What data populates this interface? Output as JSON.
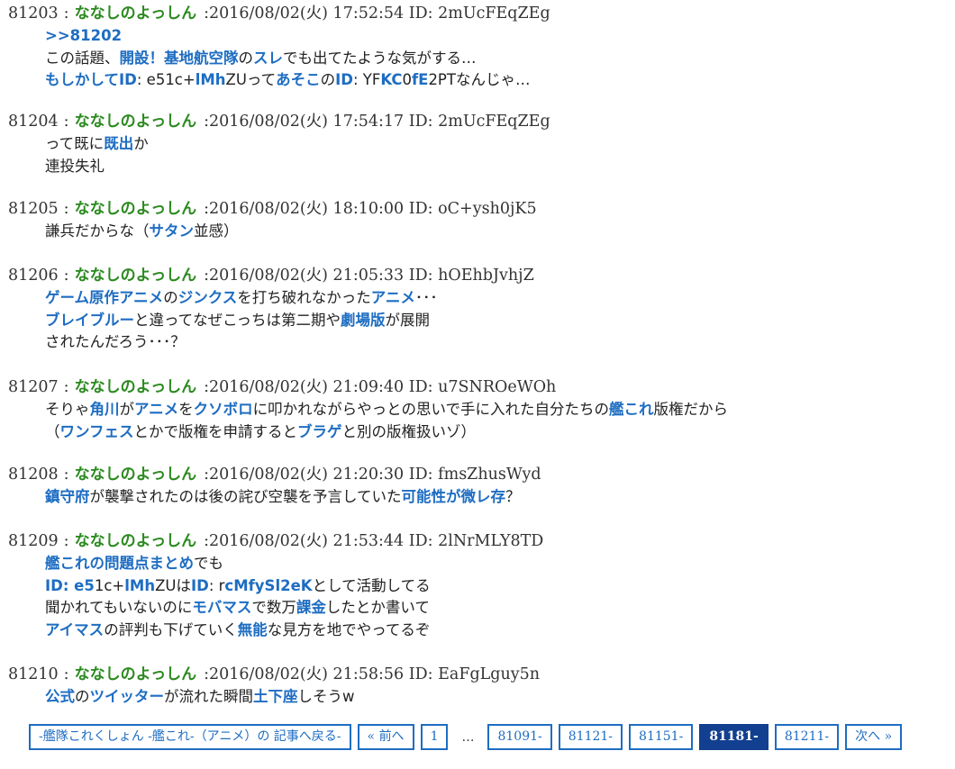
{
  "posts": [
    {
      "num": "81203",
      "name": "ななしのよっしん",
      "date": ":2016/08/02(火) 17:52:54 ID: 2mUcFEqZEg",
      "lines": [
        [
          {
            "t": ">>81202",
            "link": true
          }
        ],
        [
          {
            "t": "この話題、"
          },
          {
            "t": "開設！基地航空隊",
            "link": true
          },
          {
            "t": "の"
          },
          {
            "t": "スレ",
            "link": true
          },
          {
            "t": "でも出てたような気がする…"
          }
        ],
        [
          {
            "t": "もしかして",
            "link": true
          },
          {
            "t": "ID",
            "link": true
          },
          {
            "t": ": e5",
            "id": true
          },
          {
            "t": "1c+",
            "id": true
          },
          {
            "t": "lMh",
            "link": true
          },
          {
            "t": "ZUって"
          },
          {
            "t": "あそこ",
            "link": true
          },
          {
            "t": "の"
          },
          {
            "t": "ID",
            "link": true
          },
          {
            "t": ": YF"
          },
          {
            "t": "KC",
            "link": true
          },
          {
            "t": "0"
          },
          {
            "t": "fE",
            "link": true
          },
          {
            "t": "2PTなんじゃ…"
          }
        ]
      ]
    },
    {
      "num": "81204",
      "name": "ななしのよっしん",
      "date": ":2016/08/02(火) 17:54:17 ID: 2mUcFEqZEg",
      "lines": [
        [
          {
            "t": "って既に"
          },
          {
            "t": "既出",
            "link": true
          },
          {
            "t": "か"
          }
        ],
        [
          {
            "t": "連投失礼"
          }
        ]
      ]
    },
    {
      "num": "81205",
      "name": "ななしのよっしん",
      "date": ":2016/08/02(火) 18:10:00 ID: oC+ysh0jK5",
      "lines": [
        [
          {
            "t": "謙兵だからな（"
          },
          {
            "t": "サタン",
            "link": true
          },
          {
            "t": "並感）"
          }
        ]
      ]
    },
    {
      "num": "81206",
      "name": "ななしのよっしん",
      "date": ":2016/08/02(火) 21:05:33 ID: hOEhbJvhjZ",
      "lines": [
        [
          {
            "t": "ゲーム",
            "link": true
          },
          {
            "t": "原作",
            "link": true
          },
          {
            "t": "アニメ",
            "link": true
          },
          {
            "t": "の"
          },
          {
            "t": "ジンクス",
            "link": true
          },
          {
            "t": "を打ち破れなかった"
          },
          {
            "t": "アニメ",
            "link": true
          },
          {
            "t": "･･･"
          }
        ],
        [
          {
            "t": "ブレイブルー",
            "link": true
          },
          {
            "t": "と違ってなぜこっちは第二期や"
          },
          {
            "t": "劇場版",
            "link": true
          },
          {
            "t": "が展開"
          }
        ],
        [
          {
            "t": "されたんだろう･･･？"
          }
        ]
      ]
    },
    {
      "num": "81207",
      "name": "ななしのよっしん",
      "date": ":2016/08/02(火) 21:09:40 ID: u7SNROeWOh",
      "lines": [
        [
          {
            "t": "そりゃ"
          },
          {
            "t": "角川",
            "link": true
          },
          {
            "t": "が"
          },
          {
            "t": "アニメ",
            "link": true
          },
          {
            "t": "を"
          },
          {
            "t": "クソボロ",
            "link": true
          },
          {
            "t": "に叩かれながらやっとの思いで手に入れた自分たちの"
          },
          {
            "t": "艦これ",
            "link": true
          },
          {
            "t": "版権だから"
          }
        ],
        [
          {
            "t": "（"
          },
          {
            "t": "ワンフェス",
            "link": true
          },
          {
            "t": "とかで版権を申請すると"
          },
          {
            "t": "ブラゲ",
            "link": true
          },
          {
            "t": "と別の版権扱いゾ）"
          }
        ]
      ]
    },
    {
      "num": "81208",
      "name": "ななしのよっしん",
      "date": ":2016/08/02(火) 21:20:30 ID: fmsZhusWyd",
      "lines": [
        [
          {
            "t": "鎮守府",
            "link": true
          },
          {
            "t": "が襲撃されたのは後の詫び空襲を予言していた"
          },
          {
            "t": "可能性が微レ存",
            "link": true
          },
          {
            "t": "？"
          }
        ]
      ]
    },
    {
      "num": "81209",
      "name": "ななしのよっしん",
      "date": ":2016/08/02(火) 21:53:44 ID: 2lNrMLY8TD",
      "lines": [
        [
          {
            "t": "艦これの問題点まとめ",
            "link": true
          },
          {
            "t": "でも"
          }
        ],
        [
          {
            "t": "ID",
            "link": true
          },
          {
            "t": ": e5",
            "link": true
          },
          {
            "t": "1c+"
          },
          {
            "t": "lMh",
            "link": true
          },
          {
            "t": "ZUは"
          },
          {
            "t": "ID",
            "link": true
          },
          {
            "t": ": r"
          },
          {
            "t": "cMfySl2eK",
            "link": true
          },
          {
            "t": "として活動してる"
          }
        ],
        [
          {
            "t": "聞かれてもいないのに"
          },
          {
            "t": "モバマス",
            "link": true
          },
          {
            "t": "で数万"
          },
          {
            "t": "課金",
            "link": true
          },
          {
            "t": "したとか書いて"
          }
        ],
        [
          {
            "t": "アイマス",
            "link": true
          },
          {
            "t": "の評判も下げていく"
          },
          {
            "t": "無能",
            "link": true
          },
          {
            "t": "な見方を地でやってるぞ"
          }
        ]
      ]
    },
    {
      "num": "81210",
      "name": "ななしのよっしん",
      "date": ":2016/08/02(火) 21:58:56 ID: EaFgLguy5n",
      "lines": [
        [
          {
            "t": "公式",
            "link": true
          },
          {
            "t": "の"
          },
          {
            "t": "ツイッター",
            "link": true
          },
          {
            "t": "が流れた瞬間"
          },
          {
            "t": "土下座",
            "link": true
          },
          {
            "t": "しそうw"
          }
        ]
      ]
    }
  ],
  "header_sep": ":",
  "pager": {
    "back_label": "-艦隊これくしょん -艦これ-（アニメ）の 記事へ戻る-",
    "prev_label": "« 前へ",
    "page_first": "1",
    "ellipsis": "…",
    "pages": [
      "81091-",
      "81121-",
      "81151-",
      "81181-",
      "81211-"
    ],
    "current": "81181-",
    "next_label": "次へ »"
  },
  "colors": {
    "name": "#2b8a1f",
    "link": "#1e6dc2",
    "pager_border": "#1e6dc2",
    "pager_current_bg": "#123f8f"
  }
}
